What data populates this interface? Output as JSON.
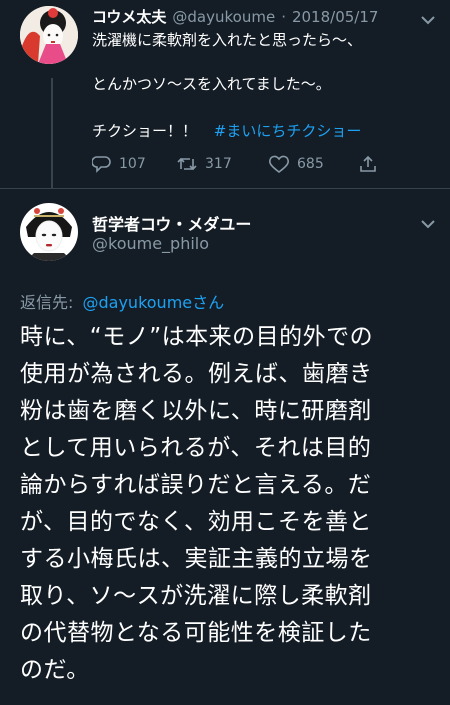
{
  "tweet1": {
    "display_name": "コウメ太夫",
    "handle": "@dayukoume",
    "date_sep": "·",
    "date": "2018/05/17",
    "line1": "洗濯機に柔軟剤を入れたと思ったら〜、",
    "line2": "とんかつソ〜スを入れてました〜。",
    "line3": "チクショー！！",
    "hashtag": "#まいにちチクショー",
    "reply_count": "107",
    "retweet_count": "317",
    "like_count": "685"
  },
  "tweet2": {
    "display_name": "哲学者コウ・メダユー",
    "handle": "@koume_philo",
    "reply_to_label": "返信先:",
    "reply_to_handle": "@dayukoume",
    "reply_to_suffix": "さん",
    "body_lines": [
      "時に、“モノ”は本来の目的外での",
      "使用が為される。例えば、歯磨き",
      "粉は歯を磨く以外に、時に研磨剤",
      "として用いられるが、それは目的",
      "論からすれば誤りだと言える。だ",
      "が、目的でなく、効用こそを善と",
      "する小梅氏は、実証主義的立場を",
      "取り、ソ〜スが洗濯に際し柔軟剤",
      "の代替物となる可能性を検証した",
      "のだ。"
    ]
  },
  "colors": {
    "background": "#141d26",
    "text": "#ffffff",
    "muted": "#8899a6",
    "link": "#1da1f2",
    "divider": "#38444d"
  },
  "icons": {
    "reply": "reply-icon",
    "retweet": "retweet-icon",
    "like": "heart-icon",
    "share": "share-icon",
    "more": "chevron-down-icon"
  }
}
